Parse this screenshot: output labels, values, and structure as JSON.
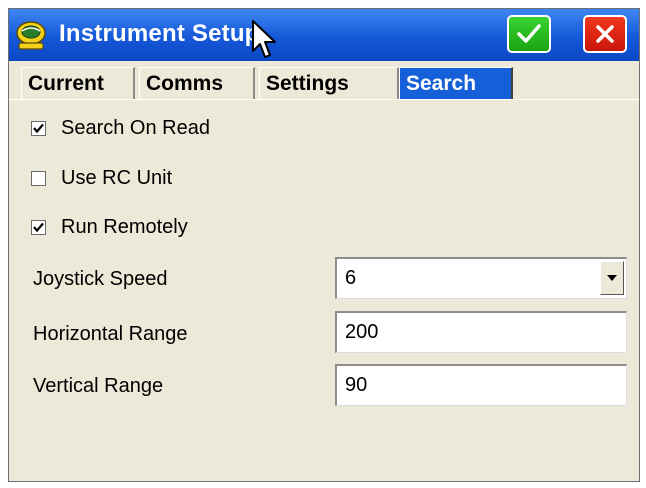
{
  "window": {
    "title": "Instrument Setup",
    "ok_icon": "checkmark-icon",
    "close_icon": "close-icon",
    "title_color": "#1558d8",
    "ok_color": "#1aa312",
    "close_color": "#c9160a"
  },
  "tabs": [
    {
      "label": "Current",
      "active": false
    },
    {
      "label": "Comms",
      "active": false
    },
    {
      "label": "Settings",
      "active": false
    },
    {
      "label": "Search",
      "active": true
    }
  ],
  "options": {
    "search_on_read": {
      "label": "Search On Read",
      "checked": true
    },
    "use_rc_unit": {
      "label": "Use RC Unit",
      "checked": false
    },
    "run_remotely": {
      "label": "Run Remotely",
      "checked": true
    }
  },
  "fields": {
    "joystick_speed": {
      "label": "Joystick Speed",
      "value": "6"
    },
    "horizontal_range": {
      "label": "Horizontal Range",
      "value": "200"
    },
    "vertical_range": {
      "label": "Vertical Range",
      "value": "90"
    }
  }
}
